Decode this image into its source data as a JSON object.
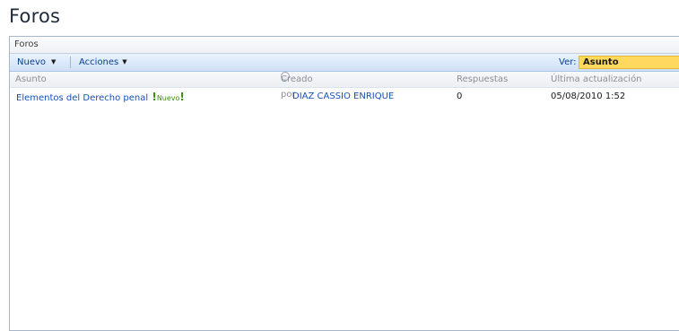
{
  "page": {
    "title": "Foros"
  },
  "panel": {
    "header": "Foros"
  },
  "toolbar": {
    "new_label": "Nuevo",
    "actions_label": "Acciones",
    "view_label": "Ver:",
    "view_value": "Asunto"
  },
  "columns": {
    "subject": "Asunto",
    "created_by": "Creado por",
    "replies": "Respuestas",
    "last_update": "Última actualización"
  },
  "rows": [
    {
      "subject": "Elementos del Derecho penal",
      "new_badge": "Nuevo",
      "created_by": "DIAZ CASSIO ENRIQUE",
      "replies": "0",
      "last_update": "05/08/2010 1:52"
    }
  ],
  "colors": {
    "link": "#1750b8",
    "toolbar_bg": "#cfe1f7",
    "view_select_bg": "#ffd85e",
    "new_badge": "#3d8d12"
  }
}
